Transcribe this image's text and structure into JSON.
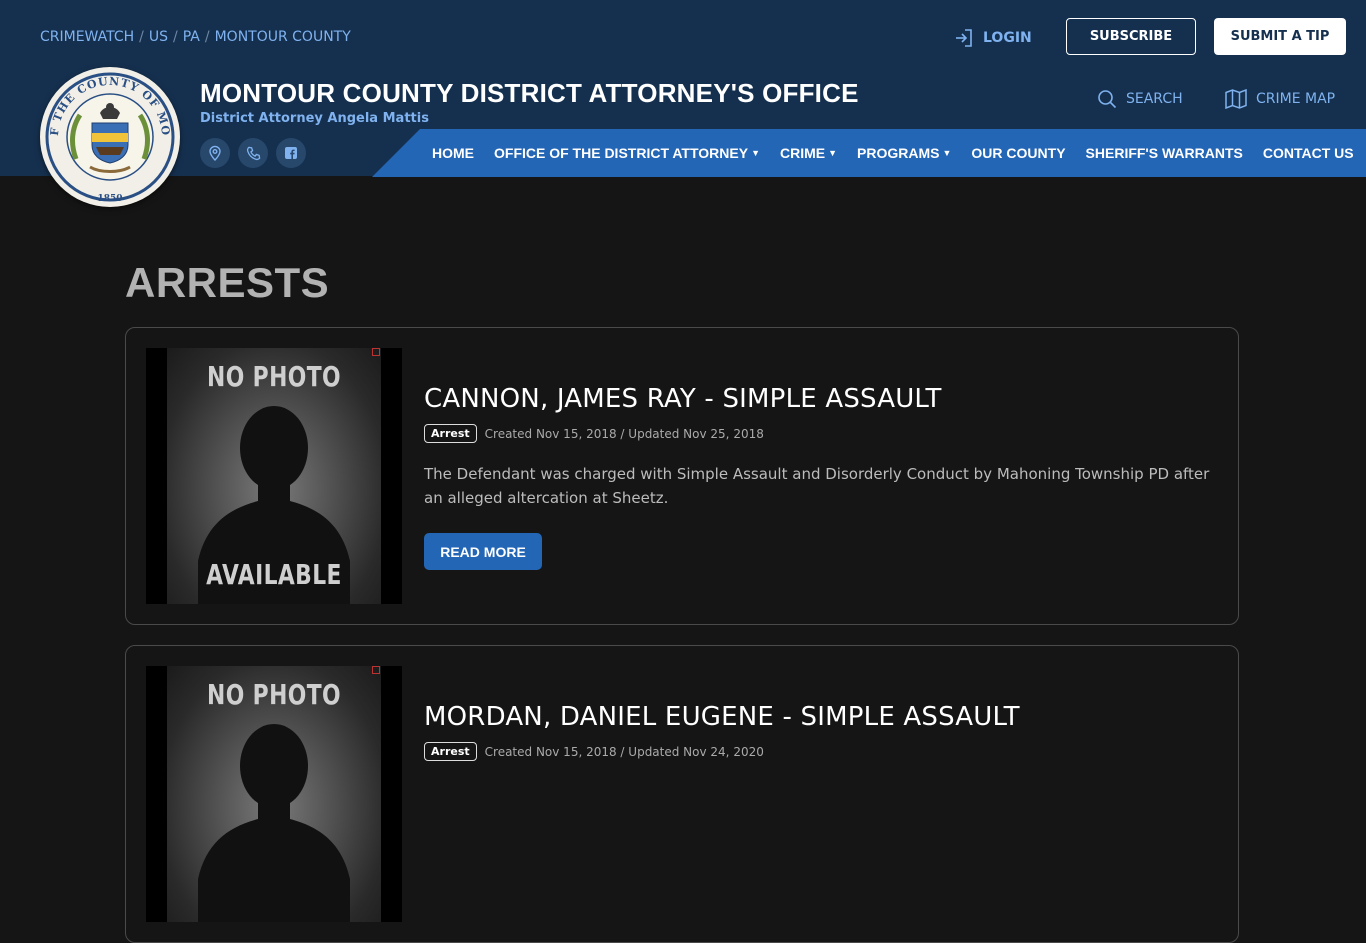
{
  "breadcrumb": [
    "CRIMEWATCH",
    "US",
    "PA",
    "MONTOUR COUNTY"
  ],
  "topbar": {
    "login": "LOGIN",
    "subscribe": "SUBSCRIBE",
    "submit_tip": "SUBMIT A TIP"
  },
  "site": {
    "title": "MONTOUR COUNTY DISTRICT ATTORNEY'S OFFICE",
    "subtitle": "District Attorney Angela Mattis",
    "seal_text_top": "SEAL OF THE COUNTY OF MONTOUR",
    "seal_year": "1850"
  },
  "tools": {
    "search": "SEARCH",
    "crime_map": "CRIME MAP"
  },
  "nav": [
    {
      "label": "HOME",
      "dropdown": false
    },
    {
      "label": "OFFICE OF THE DISTRICT ATTORNEY",
      "dropdown": true
    },
    {
      "label": "CRIME",
      "dropdown": true
    },
    {
      "label": "PROGRAMS",
      "dropdown": true
    },
    {
      "label": "OUR COUNTY",
      "dropdown": false
    },
    {
      "label": "SHERIFF'S WARRANTS",
      "dropdown": false
    },
    {
      "label": "CONTACT US",
      "dropdown": false
    }
  ],
  "page": {
    "heading": "ARRESTS"
  },
  "placeholder_photo": {
    "top": "NO PHOTO",
    "bottom": "AVAILABLE"
  },
  "arrests": [
    {
      "title": "CANNON, JAMES RAY - SIMPLE ASSAULT",
      "badge": "Arrest",
      "dates": "Created Nov 15, 2018 / Updated Nov 25, 2018",
      "description": "The Defendant was charged with Simple Assault and Disorderly Conduct by Mahoning Township PD after an alleged altercation at Sheetz.",
      "read_more": "READ MORE"
    },
    {
      "title": "MORDAN, DANIEL EUGENE - SIMPLE ASSAULT",
      "badge": "Arrest",
      "dates": "Created Nov 15, 2018 / Updated Nov 24, 2020"
    }
  ],
  "colors": {
    "header_bg": "#15304f",
    "nav_bg": "#2466b6",
    "link": "#7fb2ef",
    "page_bg": "#151515"
  }
}
